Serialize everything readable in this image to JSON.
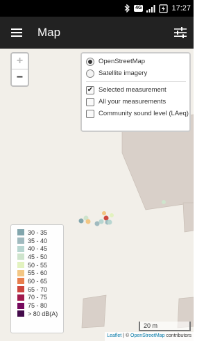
{
  "status_bar": {
    "network": "4G",
    "time": "17:27",
    "icons": [
      "bluetooth-icon",
      "signal-icon",
      "battery-icon"
    ]
  },
  "app_bar": {
    "title": "Map",
    "menu_icon": "hamburger-menu-icon",
    "action_icon": "tune-sliders-icon"
  },
  "map": {
    "zoom_in": "+",
    "zoom_out": "−",
    "layers": {
      "base": [
        {
          "label": "OpenStreetMap",
          "selected": true
        },
        {
          "label": "Satellite imagery",
          "selected": false
        }
      ],
      "overlays": [
        {
          "label": "Selected measurement",
          "checked": true
        },
        {
          "label": "All your measurements",
          "checked": false
        },
        {
          "label": "Community sound level (LAeq)",
          "checked": false
        }
      ]
    },
    "legend": [
      {
        "label": "30 - 35",
        "color": "#82a6ad"
      },
      {
        "label": "35 - 40",
        "color": "#a0babf"
      },
      {
        "label": "40 - 45",
        "color": "#b8d6d1"
      },
      {
        "label": "45 - 50",
        "color": "#cee4cc"
      },
      {
        "label": "50 - 55",
        "color": "#e2f2bf"
      },
      {
        "label": "55 - 60",
        "color": "#f3c683"
      },
      {
        "label": "60 - 65",
        "color": "#e87e4d"
      },
      {
        "label": "65 - 70",
        "color": "#cd463e"
      },
      {
        "label": "70 - 75",
        "color": "#a11a4d"
      },
      {
        "label": "75 - 80",
        "color": "#75085c"
      },
      {
        "label": "> 80 dB(A)",
        "color": "#430a4a"
      }
    ],
    "scale": "20 m",
    "attribution": {
      "leaflet": "Leaflet",
      "separator": " | © ",
      "osm": "OpenStreetMap",
      "suffix": " contributors"
    }
  }
}
